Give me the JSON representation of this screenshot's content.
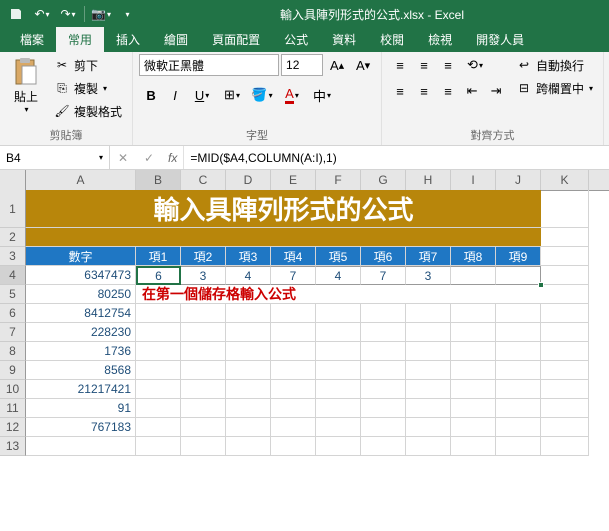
{
  "title": "輸入具陣列形式的公式.xlsx - Excel",
  "tabs": [
    "檔案",
    "常用",
    "插入",
    "繪圖",
    "頁面配置",
    "公式",
    "資料",
    "校閱",
    "檢視",
    "開發人員"
  ],
  "active_tab": 1,
  "clipboard": {
    "paste": "貼上",
    "cut": "剪下",
    "copy": "複製",
    "painter": "複製格式",
    "group": "剪貼簿"
  },
  "font": {
    "name": "微軟正黑體",
    "size": "12",
    "bold": "B",
    "italic": "I",
    "underline": "U",
    "group": "字型"
  },
  "align": {
    "wrap": "自動換行",
    "merge": "跨欄置中",
    "group": "對齊方式"
  },
  "name_box": "B4",
  "formula": "=MID($A4,COLUMN(A:I),1)",
  "cols": [
    "A",
    "B",
    "C",
    "D",
    "E",
    "F",
    "G",
    "H",
    "I",
    "J",
    "K"
  ],
  "merged_title": "輸入具陣列形式的公式",
  "headers": [
    "數字",
    "項1",
    "項2",
    "項3",
    "項4",
    "項5",
    "項6",
    "項7",
    "項8",
    "項9"
  ],
  "row4_num": "6347473",
  "row4_vals": [
    "6",
    "3",
    "4",
    "7",
    "4",
    "7",
    "3"
  ],
  "nums": [
    "80250",
    "8412754",
    "228230",
    "1736",
    "8568",
    "21217421",
    "91",
    "767183"
  ],
  "annotation": "在第一個儲存格輸入公式"
}
